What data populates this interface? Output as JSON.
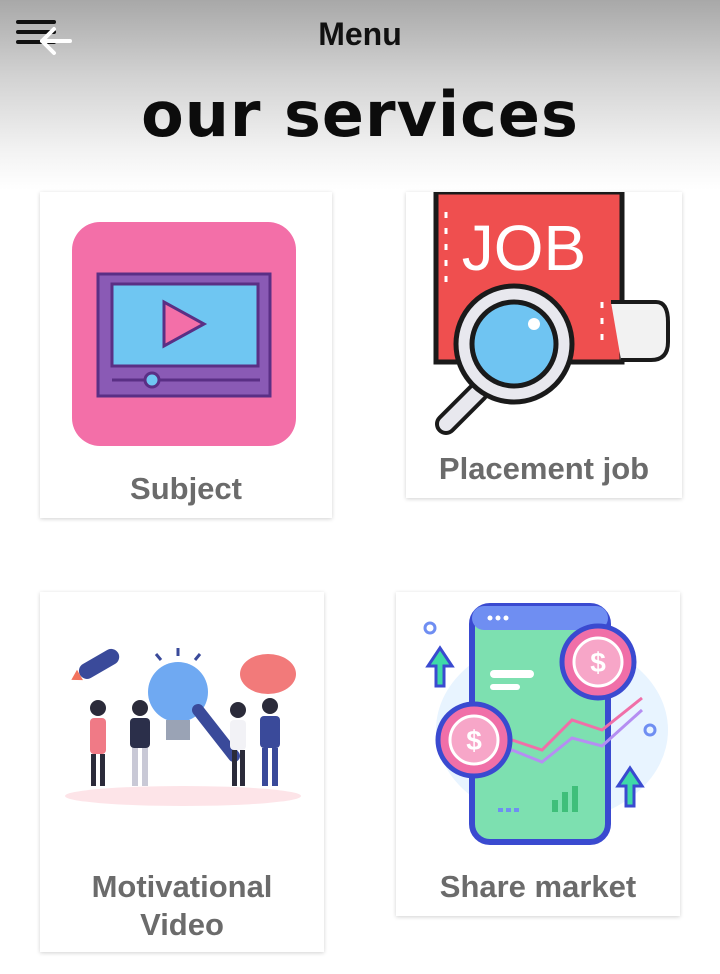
{
  "header": {
    "title": "Menu",
    "menu_icon": "hamburger-back-arrow-icon"
  },
  "page": {
    "title": "our services"
  },
  "services": [
    {
      "label": "Subject",
      "icon": "video-player-icon"
    },
    {
      "label": "Placement job",
      "icon": "job-search-icon"
    },
    {
      "label_line1": "Motivational",
      "label_line2": "Video",
      "icon": "motivation-people-icon"
    },
    {
      "label": "Share market",
      "icon": "stock-app-icon"
    }
  ],
  "colors": {
    "label_text": "#6b6b6b",
    "subject_bg": "#f36fa8",
    "job_red": "#ef4f4f",
    "accent_blue": "#6fc4f2"
  }
}
